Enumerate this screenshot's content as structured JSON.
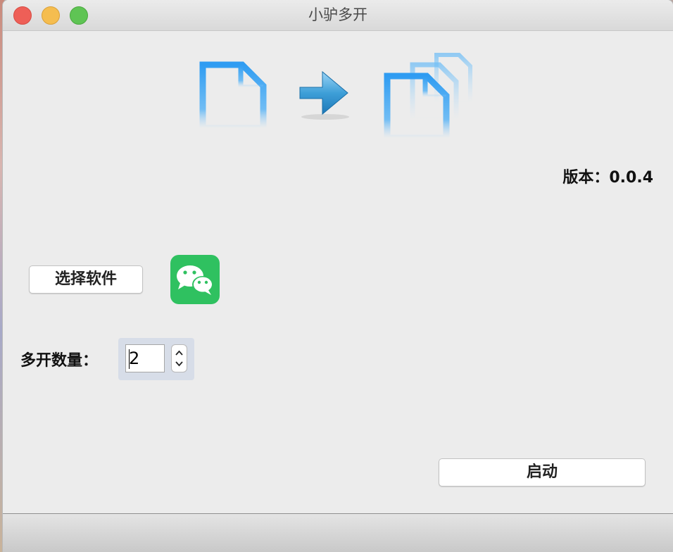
{
  "window": {
    "title": "小驴多开",
    "traffic_lights": {
      "close": "#ee5f57",
      "minimize": "#f5bd4f",
      "maximize": "#5fc454"
    }
  },
  "hero": {
    "icons": [
      "single-document-icon",
      "arrow-right-icon",
      "multiple-documents-icon"
    ],
    "accent_color": "#3aa3f0"
  },
  "version_text": "版本：0.0.4",
  "select_button_label": "选择软件",
  "selected_app_icon": "wechat-icon",
  "count": {
    "label": "多开数量：",
    "value": "2"
  },
  "start_button_label": "启动"
}
